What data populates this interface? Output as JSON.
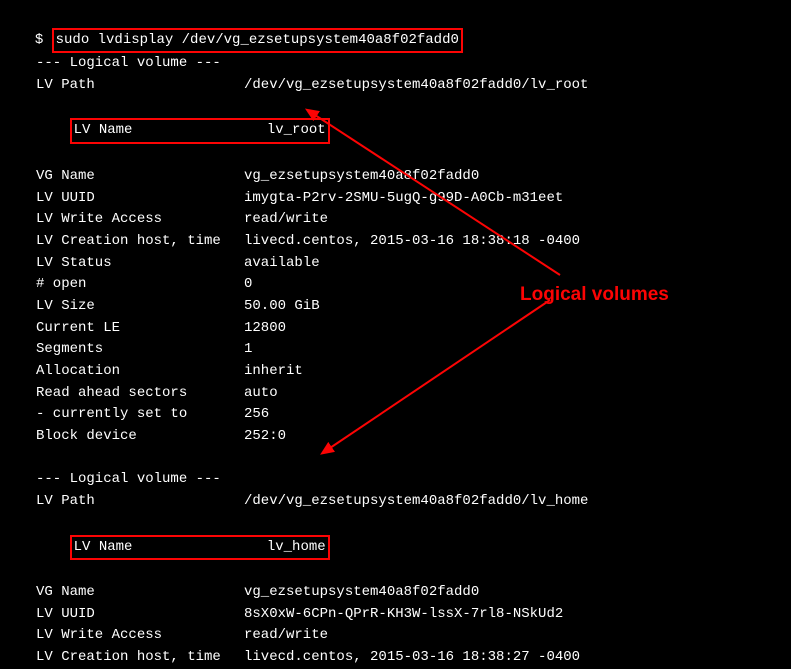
{
  "prompt": "$ ",
  "command": "sudo lvdisplay /dev/vg_ezsetupsystem40a8f02fadd0",
  "section_header": "--- Logical volume ---",
  "annotation": "Logical volumes",
  "lv1": {
    "path_label": "LV Path",
    "path_value": "/dev/vg_ezsetupsystem40a8f02fadd0/lv_root",
    "name_label": "LV Name",
    "name_value": "lv_root",
    "vgname_label": "VG Name",
    "vgname_value": "vg_ezsetupsystem40a8f02fadd0",
    "uuid_label": "LV UUID",
    "uuid_value": "imygta-P2rv-2SMU-5ugQ-g99D-A0Cb-m31eet",
    "waccess_label": "LV Write Access",
    "waccess_value": "read/write",
    "ctime_label": "LV Creation host, time",
    "ctime_value": "livecd.centos, 2015-03-16 18:38:18 -0400",
    "status_label": "LV Status",
    "status_value": "available",
    "open_label": "# open",
    "open_value": "0",
    "size_label": "LV Size",
    "size_value": "50.00 GiB",
    "curle_label": "Current LE",
    "curle_value": "12800",
    "segments_label": "Segments",
    "segments_value": "1",
    "alloc_label": "Allocation",
    "alloc_value": "inherit",
    "rahead_label": "Read ahead sectors",
    "rahead_value": "auto",
    "cset_label": "- currently set to",
    "cset_value": "256",
    "blkdev_label": "Block device",
    "blkdev_value": "252:0"
  },
  "lv2": {
    "path_label": "LV Path",
    "path_value": "/dev/vg_ezsetupsystem40a8f02fadd0/lv_home",
    "name_label": "LV Name",
    "name_value": "lv_home",
    "vgname_label": "VG Name",
    "vgname_value": "vg_ezsetupsystem40a8f02fadd0",
    "uuid_label": "LV UUID",
    "uuid_value": "8sX0xW-6CPn-QPrR-KH3W-lssX-7rl8-NSkUd2",
    "waccess_label": "LV Write Access",
    "waccess_value": "read/write",
    "ctime_label": "LV Creation host, time",
    "ctime_value": "livecd.centos, 2015-03-16 18:38:27 -0400"
  }
}
